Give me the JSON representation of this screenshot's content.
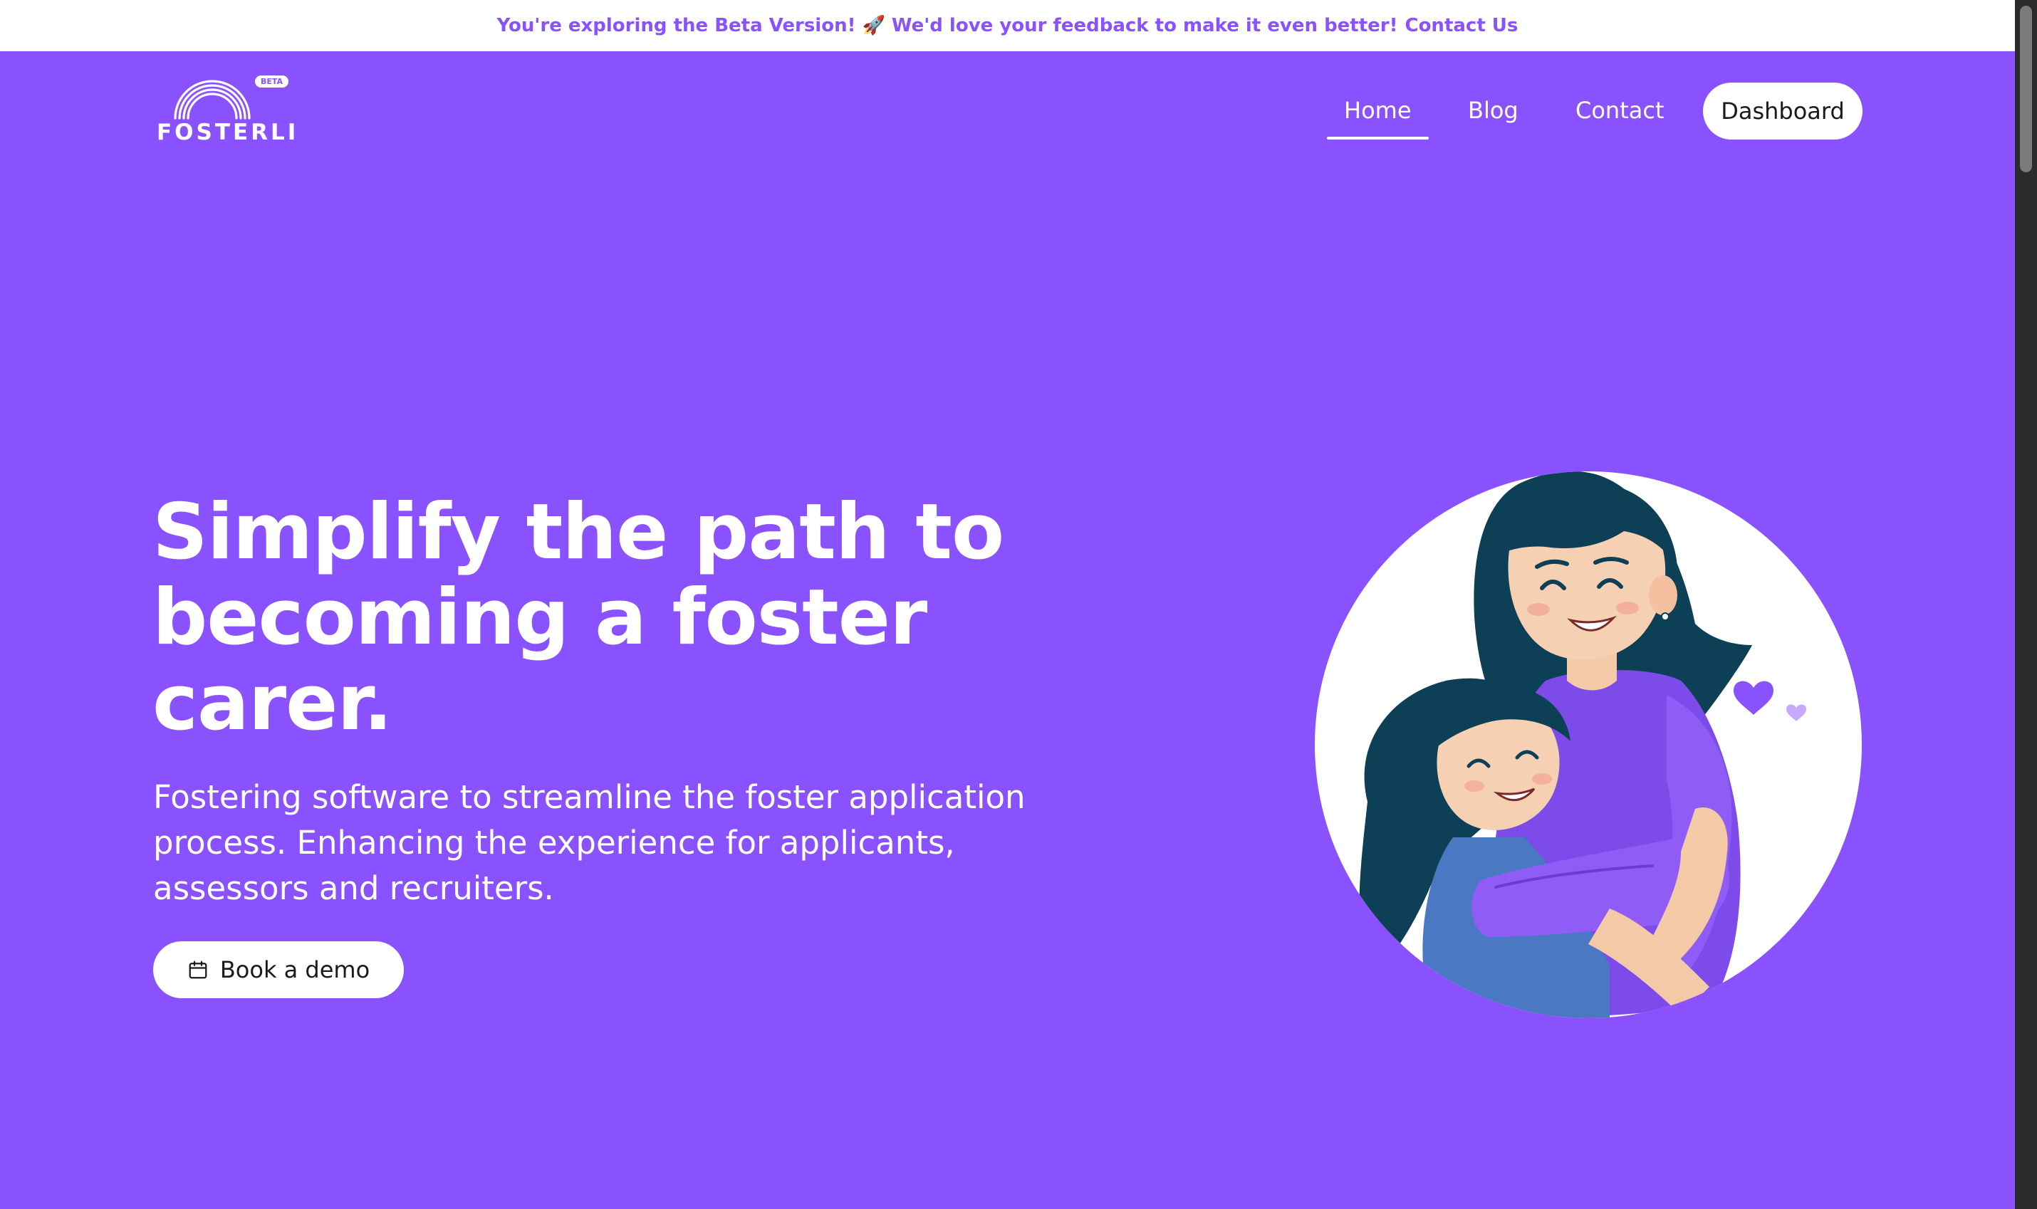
{
  "announcement": {
    "text": "You're exploring the Beta Version! 🚀 We'd love your feedback to make it even better!",
    "link_label": "Contact Us"
  },
  "header": {
    "logo_text": "FOSTERLI",
    "beta_badge": "BETA",
    "nav": {
      "home": "Home",
      "blog": "Blog",
      "contact": "Contact",
      "dashboard": "Dashboard"
    },
    "active_nav": "Home"
  },
  "hero": {
    "title": "Simplify the path to becoming a foster carer.",
    "subtitle": "Fostering software to streamline the foster application process. Enhancing the experience for applicants, assessors and recruiters.",
    "cta_label": "Book a demo",
    "cta_icon": "calendar-icon",
    "illustration": "mother-hugging-child-illustration"
  },
  "colors": {
    "brand": "#8a52fe",
    "text_on_brand": "#ffffff",
    "button_bg": "#ffffff",
    "button_text": "#1a1a1a"
  }
}
